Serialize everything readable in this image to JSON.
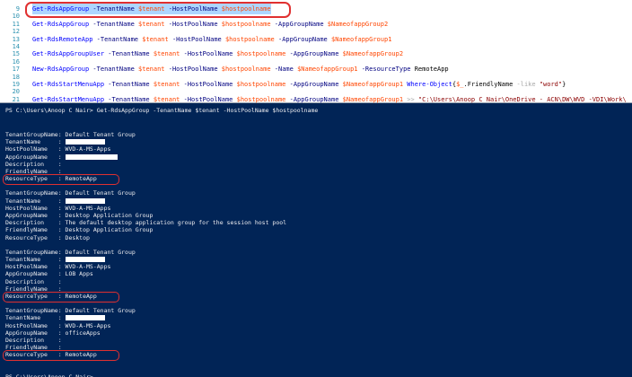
{
  "editor": {
    "lines": [
      {
        "num": "9",
        "parts": [
          {
            "t": "Get-RdsAppGroup",
            "c": "cmd"
          },
          {
            "t": " -TenantName ",
            "c": "param"
          },
          {
            "t": "$tenant",
            "c": "var"
          },
          {
            "t": " -HostPoolName ",
            "c": "param"
          },
          {
            "t": "$hostpoolname",
            "c": "var"
          }
        ]
      },
      {
        "num": "10",
        "parts": []
      },
      {
        "num": "11",
        "parts": [
          {
            "t": "Get-RdsAppGroup",
            "c": "cmd"
          },
          {
            "t": " -TenantName ",
            "c": "param"
          },
          {
            "t": "$tenant",
            "c": "var"
          },
          {
            "t": " -HostPoolName ",
            "c": "param"
          },
          {
            "t": "$hostpoolname",
            "c": "var"
          },
          {
            "t": " -AppGroupName ",
            "c": "param"
          },
          {
            "t": "$NameofappGroup2",
            "c": "var"
          }
        ]
      },
      {
        "num": "12",
        "parts": []
      },
      {
        "num": "13",
        "parts": [
          {
            "t": "Get-RdsRemoteApp",
            "c": "cmd"
          },
          {
            "t": " -TenantName ",
            "c": "param"
          },
          {
            "t": "$tenant",
            "c": "var"
          },
          {
            "t": " -HostPoolName ",
            "c": "param"
          },
          {
            "t": "$hostpoolname",
            "c": "var"
          },
          {
            "t": " -AppGroupName ",
            "c": "param"
          },
          {
            "t": "$NameofappGroup1",
            "c": "var"
          }
        ]
      },
      {
        "num": "14",
        "parts": []
      },
      {
        "num": "15",
        "parts": [
          {
            "t": "Get-RdsAppGroupUser",
            "c": "cmd"
          },
          {
            "t": " -TenantName ",
            "c": "param"
          },
          {
            "t": "$tenant",
            "c": "var"
          },
          {
            "t": " -HostPoolName ",
            "c": "param"
          },
          {
            "t": "$hostpoolname",
            "c": "var"
          },
          {
            "t": " -AppGroupName ",
            "c": "param"
          },
          {
            "t": "$NameofappGroup2",
            "c": "var"
          }
        ]
      },
      {
        "num": "16",
        "parts": []
      },
      {
        "num": "17",
        "parts": [
          {
            "t": "New-RdsAppGroup",
            "c": "cmd"
          },
          {
            "t": " -TenantName ",
            "c": "param"
          },
          {
            "t": "$tenant",
            "c": "var"
          },
          {
            "t": " -HostPoolName ",
            "c": "param"
          },
          {
            "t": "$hostpoolname",
            "c": "var"
          },
          {
            "t": " -Name ",
            "c": "param"
          },
          {
            "t": "$NameofappGroup1",
            "c": "var"
          },
          {
            "t": " -ResourceType ",
            "c": "param"
          },
          {
            "t": "RemoteApp",
            "c": "plain"
          }
        ]
      },
      {
        "num": "18",
        "parts": []
      },
      {
        "num": "19",
        "parts": [
          {
            "t": "Get-RdsStartMenuApp",
            "c": "cmd"
          },
          {
            "t": " -TenantName ",
            "c": "param"
          },
          {
            "t": "$tenant",
            "c": "var"
          },
          {
            "t": " -HostPoolName ",
            "c": "param"
          },
          {
            "t": "$hostpoolname",
            "c": "var"
          },
          {
            "t": " -AppGroupName ",
            "c": "param"
          },
          {
            "t": "$NameofappGroup1",
            "c": "var"
          },
          {
            "t": " Where-Object",
            "c": "cmd"
          },
          {
            "t": "{",
            "c": "plain"
          },
          {
            "t": "$_",
            "c": "var"
          },
          {
            "t": ".FriendlyName ",
            "c": "plain"
          },
          {
            "t": "-like",
            "c": "op"
          },
          {
            "t": " \"word\"",
            "c": "str"
          },
          {
            "t": "}",
            "c": "plain"
          }
        ]
      },
      {
        "num": "20",
        "parts": []
      },
      {
        "num": "21",
        "parts": [
          {
            "t": "Get-RdsStartMenuApp",
            "c": "cmd"
          },
          {
            "t": " -TenantName ",
            "c": "param"
          },
          {
            "t": "$tenant",
            "c": "var"
          },
          {
            "t": " -HostPoolName ",
            "c": "param"
          },
          {
            "t": "$hostpoolname",
            "c": "var"
          },
          {
            "t": " -AppGroupName ",
            "c": "param"
          },
          {
            "t": "$NameofappGroup1",
            "c": "var"
          },
          {
            "t": " >> ",
            "c": "op"
          },
          {
            "t": "\"C:\\Users\\Anoop C Nair\\OneDrive - ACN\\DW\\WVD -VDI\\Work\\",
            "c": "str"
          }
        ]
      }
    ]
  },
  "console": {
    "prompt_command": "PS C:\\Users\\Anoop C Nair> Get-RdsAppGroup -TenantName $tenant -HostPoolName $hostpoolname",
    "groups": [
      {
        "TenantGroupName": "Default Tenant Group",
        "TenantName": "",
        "HostPoolName": "WVD-A-MS-Apps",
        "AppGroupName": "",
        "Description": "",
        "FriendlyName": "",
        "ResourceType": "RemoteApp",
        "highlight": true
      },
      {
        "TenantGroupName": "Default Tenant Group",
        "TenantName": "",
        "HostPoolName": "WVD-A-MS-Apps",
        "AppGroupName": "Desktop Application Group",
        "Description": "The default desktop application group for the session host pool",
        "FriendlyName": "Desktop Application Group",
        "ResourceType": "Desktop",
        "highlight": false
      },
      {
        "TenantGroupName": "Default Tenant Group",
        "TenantName": "",
        "HostPoolName": "WVD-A-MS-Apps",
        "AppGroupName": "LOB Apps",
        "Description": "",
        "FriendlyName": "",
        "ResourceType": "RemoteApp",
        "highlight": true
      },
      {
        "TenantGroupName": "Default Tenant Group",
        "TenantName": "",
        "HostPoolName": "WVD-A-MS-Apps",
        "AppGroupName": "officeApps",
        "Description": "",
        "FriendlyName": "",
        "ResourceType": "RemoteApp",
        "highlight": true
      }
    ],
    "final_prompt": "PS C:\\Users\\Anoop C Nair>"
  },
  "colors": {
    "console_bg": "#012456",
    "highlight_ring": "#e03030"
  }
}
